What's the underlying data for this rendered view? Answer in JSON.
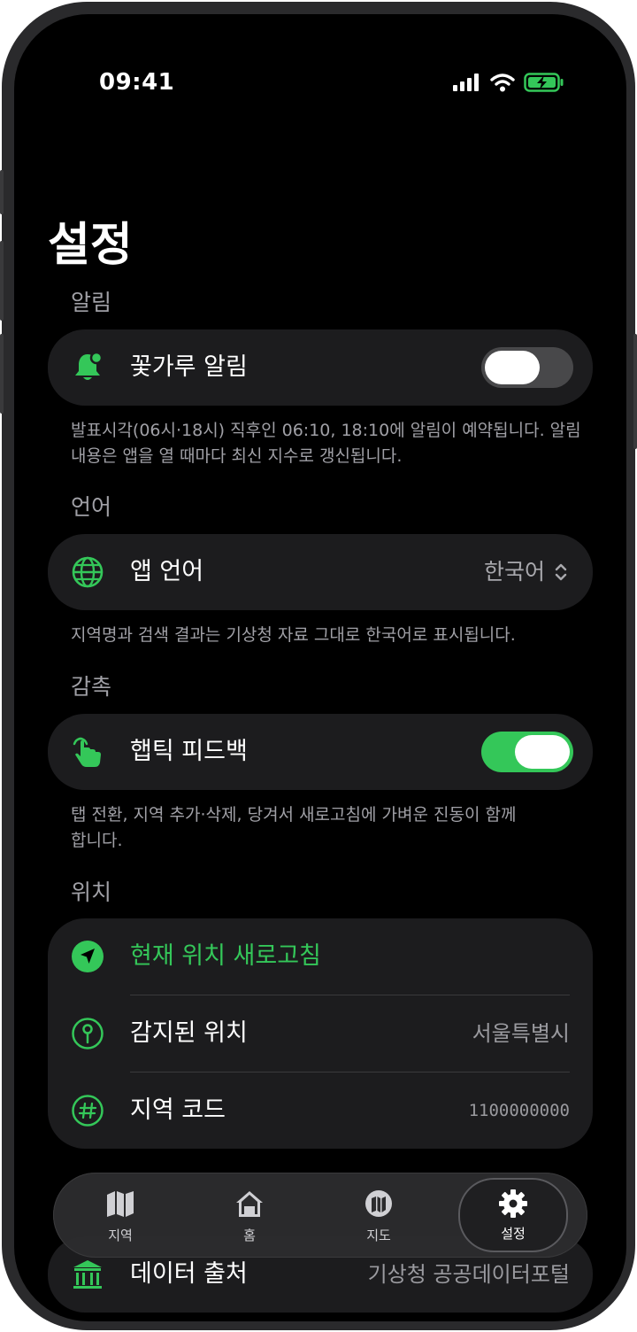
{
  "status_bar": {
    "time": "09:41"
  },
  "page_title": "설정",
  "sections": {
    "alerts": {
      "header": "알림",
      "row_label": "꽃가루 알림",
      "toggle_on": false,
      "footnote": "발표시각(06시·18시) 직후인 06:10, 18:10에 알림이 예약됩니다. 알림 내용은 앱을 열 때마다 최신 지수로 갱신됩니다."
    },
    "language": {
      "header": "언어",
      "row_label": "앱 언어",
      "value": "한국어",
      "footnote": "지역명과 검색 결과는 기상청 자료 그대로 한국어로 표시됩니다."
    },
    "haptics": {
      "header": "감촉",
      "row_label": "햅틱 피드백",
      "toggle_on": true,
      "footnote": "탭 전환, 지역 추가·삭제, 당겨서 새로고침에 가벼운 진동이 함께합니다."
    },
    "location": {
      "header": "위치",
      "refresh_label": "현재 위치 새로고침",
      "detected_label": "감지된 위치",
      "detected_value": "서울특별시",
      "code_label": "지역 코드",
      "code_value": "1100000000"
    },
    "data": {
      "source_label": "데이터 출처",
      "source_value": "기상청 공공데이터포털"
    }
  },
  "tab_bar": {
    "tabs": [
      {
        "label": "지역",
        "icon": "map-icon"
      },
      {
        "label": "홈",
        "icon": "house-icon"
      },
      {
        "label": "지도",
        "icon": "map-circle-icon"
      },
      {
        "label": "설정",
        "icon": "gear-icon",
        "active": true
      }
    ]
  },
  "colors": {
    "accent": "#34c759",
    "background": "#000000",
    "card": "#1c1c1e"
  }
}
